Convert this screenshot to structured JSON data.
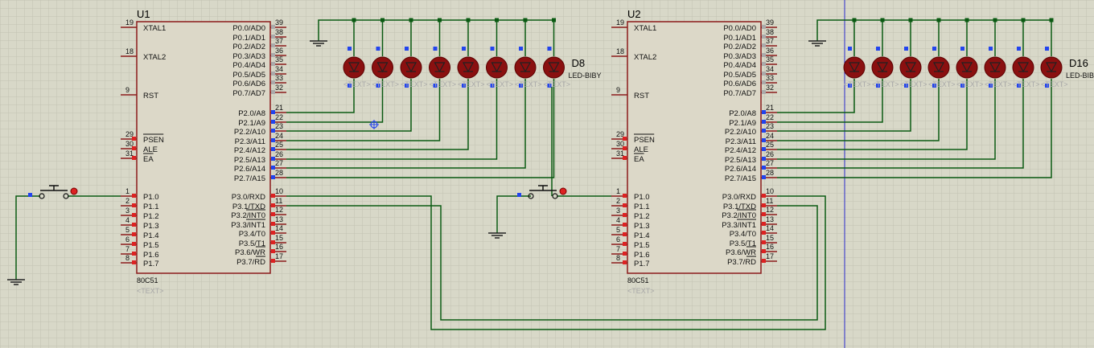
{
  "colors": {
    "background": "#d8d8c8",
    "grid": "#c2c2b2",
    "chip_fill": "#dcd8c8",
    "chip_border": "#8b1a1a",
    "wire": "#0a5a12",
    "led_fill": "#8a1010",
    "pin_marker": "#2244ee",
    "pin_red": "#dd2222",
    "cursor_line": "#2a2acc"
  },
  "chips": [
    {
      "ref": "U1",
      "part": "80C51",
      "text_placeholder": "<TEXT>",
      "left_pins": [
        {
          "num": "19",
          "name": "XTAL1"
        },
        {
          "num": "18",
          "name": "XTAL2"
        },
        {
          "num": "9",
          "name": "RST"
        },
        {
          "num": "29",
          "name": "PSEN"
        },
        {
          "num": "30",
          "name": "ALE"
        },
        {
          "num": "31",
          "name": "EA"
        },
        {
          "num": "1",
          "name": "P1.0"
        },
        {
          "num": "2",
          "name": "P1.1"
        },
        {
          "num": "3",
          "name": "P1.2"
        },
        {
          "num": "4",
          "name": "P1.3"
        },
        {
          "num": "5",
          "name": "P1.4"
        },
        {
          "num": "6",
          "name": "P1.5"
        },
        {
          "num": "7",
          "name": "P1.6"
        },
        {
          "num": "8",
          "name": "P1.7"
        }
      ],
      "right_pins": [
        {
          "num": "39",
          "name": "P0.0/AD0"
        },
        {
          "num": "38",
          "name": "P0.1/AD1"
        },
        {
          "num": "37",
          "name": "P0.2/AD2"
        },
        {
          "num": "36",
          "name": "P0.3/AD3"
        },
        {
          "num": "35",
          "name": "P0.4/AD4"
        },
        {
          "num": "34",
          "name": "P0.5/AD5"
        },
        {
          "num": "33",
          "name": "P0.6/AD6"
        },
        {
          "num": "32",
          "name": "P0.7/AD7"
        },
        {
          "num": "21",
          "name": "P2.0/A8"
        },
        {
          "num": "22",
          "name": "P2.1/A9"
        },
        {
          "num": "23",
          "name": "P2.2/A10"
        },
        {
          "num": "24",
          "name": "P2.3/A11"
        },
        {
          "num": "25",
          "name": "P2.4/A12"
        },
        {
          "num": "26",
          "name": "P2.5/A13"
        },
        {
          "num": "27",
          "name": "P2.6/A14"
        },
        {
          "num": "28",
          "name": "P2.7/A15"
        },
        {
          "num": "10",
          "name": "P3.0/RXD"
        },
        {
          "num": "11",
          "name": "P3.1/TXD"
        },
        {
          "num": "12",
          "name": "P3.2/INT0"
        },
        {
          "num": "13",
          "name": "P3.3/INT1"
        },
        {
          "num": "14",
          "name": "P3.4/T0"
        },
        {
          "num": "15",
          "name": "P3.5/T1"
        },
        {
          "num": "16",
          "name": "P3.6/WR"
        },
        {
          "num": "17",
          "name": "P3.7/RD"
        }
      ]
    },
    {
      "ref": "U2",
      "part": "80C51",
      "text_placeholder": "<TEXT>",
      "left_pins": [
        {
          "num": "19",
          "name": "XTAL1"
        },
        {
          "num": "18",
          "name": "XTAL2"
        },
        {
          "num": "9",
          "name": "RST"
        },
        {
          "num": "29",
          "name": "PSEN"
        },
        {
          "num": "30",
          "name": "ALE"
        },
        {
          "num": "31",
          "name": "EA"
        },
        {
          "num": "1",
          "name": "P1.0"
        },
        {
          "num": "2",
          "name": "P1.1"
        },
        {
          "num": "3",
          "name": "P1.2"
        },
        {
          "num": "4",
          "name": "P1.3"
        },
        {
          "num": "5",
          "name": "P1.4"
        },
        {
          "num": "6",
          "name": "P1.5"
        },
        {
          "num": "7",
          "name": "P1.6"
        },
        {
          "num": "8",
          "name": "P1.7"
        }
      ],
      "right_pins": [
        {
          "num": "39",
          "name": "P0.0/AD0"
        },
        {
          "num": "38",
          "name": "P0.1/AD1"
        },
        {
          "num": "37",
          "name": "P0.2/AD2"
        },
        {
          "num": "36",
          "name": "P0.3/AD3"
        },
        {
          "num": "35",
          "name": "P0.4/AD4"
        },
        {
          "num": "34",
          "name": "P0.5/AD5"
        },
        {
          "num": "33",
          "name": "P0.6/AD6"
        },
        {
          "num": "32",
          "name": "P0.7/AD7"
        },
        {
          "num": "21",
          "name": "P2.0/A8"
        },
        {
          "num": "22",
          "name": "P2.1/A9"
        },
        {
          "num": "23",
          "name": "P2.2/A10"
        },
        {
          "num": "24",
          "name": "P2.3/A11"
        },
        {
          "num": "25",
          "name": "P2.4/A12"
        },
        {
          "num": "26",
          "name": "P2.5/A13"
        },
        {
          "num": "27",
          "name": "P2.6/A14"
        },
        {
          "num": "28",
          "name": "P2.7/A15"
        },
        {
          "num": "10",
          "name": "P3.0/RXD"
        },
        {
          "num": "11",
          "name": "P3.1/TXD"
        },
        {
          "num": "12",
          "name": "P3.2/INT0"
        },
        {
          "num": "13",
          "name": "P3.3/INT1"
        },
        {
          "num": "14",
          "name": "P3.4/T0"
        },
        {
          "num": "15",
          "name": "P3.5/T1"
        },
        {
          "num": "16",
          "name": "P3.6/WR"
        },
        {
          "num": "17",
          "name": "P3.7/RD"
        }
      ]
    }
  ],
  "led_groups": [
    {
      "last_ref": "D8",
      "last_part": "LED-BIBY",
      "text_placeholder": "<TEXT>",
      "count": 8
    },
    {
      "last_ref": "D16",
      "last_part": "LED-BIBY",
      "text_placeholder": "<TEXT>",
      "count": 8
    }
  ]
}
